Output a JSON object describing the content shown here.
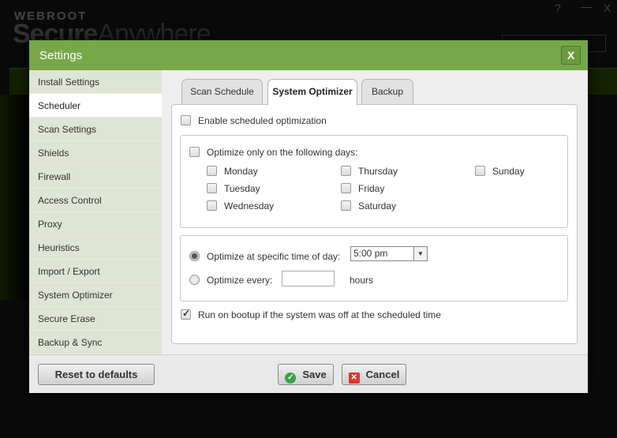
{
  "background": {
    "brand_top": "WEBROOT",
    "brand_main": "Secure",
    "brand_main2": "Anywhere",
    "help_label": "?",
    "minimize_label": "—",
    "close_label": "X"
  },
  "dialog": {
    "title": "Settings",
    "close_label": "X"
  },
  "sidebar": {
    "items": [
      {
        "label": "Install Settings"
      },
      {
        "label": "Scheduler"
      },
      {
        "label": "Scan Settings"
      },
      {
        "label": "Shields"
      },
      {
        "label": "Firewall"
      },
      {
        "label": "Access Control"
      },
      {
        "label": "Proxy"
      },
      {
        "label": "Heuristics"
      },
      {
        "label": "Import / Export"
      },
      {
        "label": "System Optimizer"
      },
      {
        "label": "Secure Erase"
      },
      {
        "label": "Backup & Sync"
      }
    ],
    "active_index": 1
  },
  "tabs": [
    {
      "label": "Scan Schedule"
    },
    {
      "label": "System Optimizer"
    },
    {
      "label": "Backup"
    }
  ],
  "optimizer": {
    "enable_label": "Enable scheduled optimization",
    "enable_checked": false,
    "days_label": "Optimize only on the following days:",
    "days_checked": false,
    "days": [
      "Monday",
      "Tuesday",
      "Wednesday",
      "Thursday",
      "Friday",
      "Saturday",
      "Sunday"
    ],
    "specific_time_label": "Optimize at specific time of day:",
    "specific_time_selected": true,
    "time_value": "5:00 pm",
    "every_label": "Optimize every:",
    "every_value": "",
    "hours_label": "hours",
    "bootup_label": "Run on bootup if the system was off at the scheduled time",
    "bootup_checked": true
  },
  "footer": {
    "reset_label": "Reset to defaults",
    "save_label": "Save",
    "cancel_label": "Cancel"
  },
  "colors": {
    "titlebar": "#76a84a",
    "sidebar": "#dfe4d4",
    "save_icon": "#3aa14a",
    "cancel_icon": "#d33a2c"
  },
  "icons": {
    "save": "check-circle-icon",
    "cancel": "x-square-icon",
    "dropdown": "dropdown-arrow-icon"
  }
}
